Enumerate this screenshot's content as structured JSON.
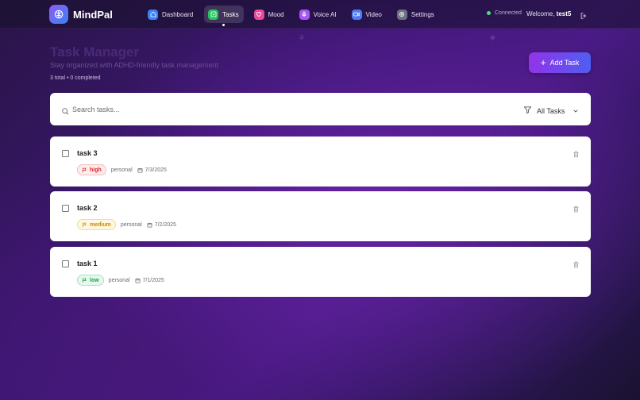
{
  "brand": {
    "name": "MindPal"
  },
  "nav": [
    {
      "label": "Dashboard",
      "icon": "home-icon",
      "color": "#3b82f6"
    },
    {
      "label": "Tasks",
      "icon": "check-square-icon",
      "color": "#22c55e",
      "active": true
    },
    {
      "label": "Mood",
      "icon": "heart-icon",
      "color": "#ec4899"
    },
    {
      "label": "Voice AI",
      "icon": "mic-icon",
      "color": "#a855f7"
    },
    {
      "label": "Video",
      "icon": "video-icon",
      "color": "#4f7bf6"
    },
    {
      "label": "Settings",
      "icon": "gear-icon",
      "color": "#6b7280"
    }
  ],
  "status": {
    "text": "Connected",
    "color": "#4ade80"
  },
  "user": {
    "welcome_prefix": "Welcome,",
    "name": "test5"
  },
  "header": {
    "title": "Task Manager",
    "subtitle": "Stay organized with ADHD-friendly task management",
    "summary": "3 total • 0 completed",
    "add_label": "Add Task"
  },
  "search": {
    "placeholder": "Search tasks...",
    "value": ""
  },
  "filter": {
    "selected": "All Tasks"
  },
  "tasks": [
    {
      "title": "task 3",
      "priority": "high",
      "category": "personal",
      "date": "7/3/2025",
      "completed": false
    },
    {
      "title": "task 2",
      "priority": "medium",
      "category": "personal",
      "date": "7/2/2025",
      "completed": false
    },
    {
      "title": "task 1",
      "priority": "low",
      "category": "personal",
      "date": "7/1/2025",
      "completed": false
    }
  ],
  "colors": {
    "accent_start": "#9333ea",
    "accent_end": "#4f5ef0",
    "priority_high": "#dc2626",
    "priority_medium": "#ca8a04",
    "priority_low": "#16a34a"
  }
}
